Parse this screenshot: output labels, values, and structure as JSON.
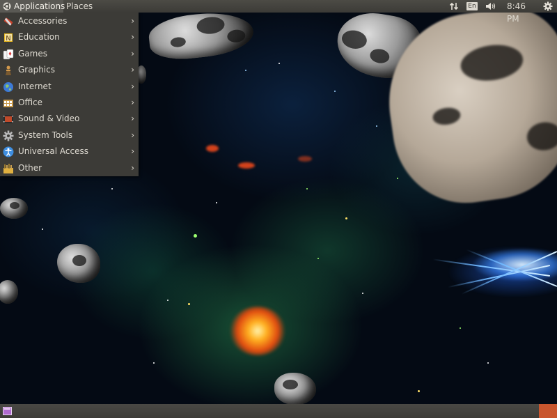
{
  "top_panel": {
    "applications_label": "Applications",
    "places_label": "Places",
    "keyboard_layout": "En",
    "clock": "8:46 PM",
    "icons": {
      "applications_logo": "ubuntu-logo-icon",
      "network": "network-updown-icon",
      "volume": "volume-icon",
      "session": "gear-icon"
    }
  },
  "applications_menu": {
    "items": [
      {
        "label": "Accessories",
        "icon": "accessories-icon",
        "color": "#c8432c"
      },
      {
        "label": "Education",
        "icon": "education-icon",
        "color": "#e8b820"
      },
      {
        "label": "Games",
        "icon": "games-icon",
        "color": "#d94040"
      },
      {
        "label": "Graphics",
        "icon": "graphics-icon",
        "color": "#d49a4c"
      },
      {
        "label": "Internet",
        "icon": "internet-icon",
        "color": "#3d7ad6"
      },
      {
        "label": "Office",
        "icon": "office-icon",
        "color": "#c89a4c"
      },
      {
        "label": "Sound & Video",
        "icon": "sound-video-icon",
        "color": "#c04a2a"
      },
      {
        "label": "System Tools",
        "icon": "system-tools-icon",
        "color": "#b8b8b8"
      },
      {
        "label": "Universal Access",
        "icon": "universal-access-icon",
        "color": "#3e8ee0"
      },
      {
        "label": "Other",
        "icon": "other-icon",
        "color": "#e0b040"
      }
    ],
    "submenu_arrow": "›"
  },
  "bottom_panel": {
    "icons": {
      "show_desktop": "show-desktop-icon",
      "trash": "trash-applet-icon"
    },
    "accent_color": "#c8562e"
  },
  "theme": {
    "panel_color": "#3c3b37",
    "panel_text": "#dfdbd2"
  }
}
